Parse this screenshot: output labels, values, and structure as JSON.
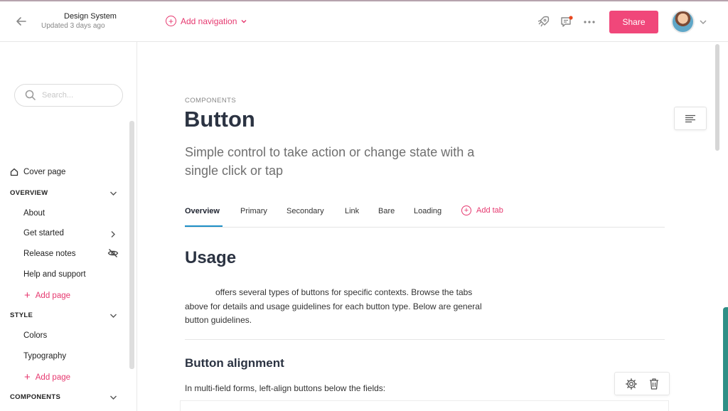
{
  "header": {
    "doc_title": "Design System",
    "updated": "Updated 3 days ago",
    "add_navigation": "Add navigation",
    "share_label": "Share"
  },
  "sidebar": {
    "search_placeholder": "Search...",
    "cover_page": "Cover page",
    "sections": [
      {
        "label": "OVERVIEW",
        "items": [
          "About",
          "Get started",
          "Release notes",
          "Help and support"
        ],
        "add_page": "Add page"
      },
      {
        "label": "STYLE",
        "items": [
          "Colors",
          "Typography"
        ],
        "add_page": "Add page"
      },
      {
        "label": "COMPONENTS"
      }
    ]
  },
  "page": {
    "eyebrow": "COMPONENTS",
    "title": "Button",
    "subtitle": "Simple control to take action or change state with a single click or tap",
    "tabs": [
      "Overview",
      "Primary",
      "Secondary",
      "Link",
      "Bare",
      "Loading"
    ],
    "active_tab": "Overview",
    "add_tab": "Add tab",
    "usage_heading": "Usage",
    "usage_text": "offers several types of buttons for specific contexts. Browse the tabs above for details and usage guidelines for each button type. Below are general button guidelines.",
    "alignment_heading": "Button alignment",
    "alignment_text": "In multi-field forms, left-align buttons below the fields:"
  },
  "colors": {
    "accent": "#e6386f",
    "share_bg": "#f0477a",
    "tab_underline": "#1e8fc6"
  }
}
